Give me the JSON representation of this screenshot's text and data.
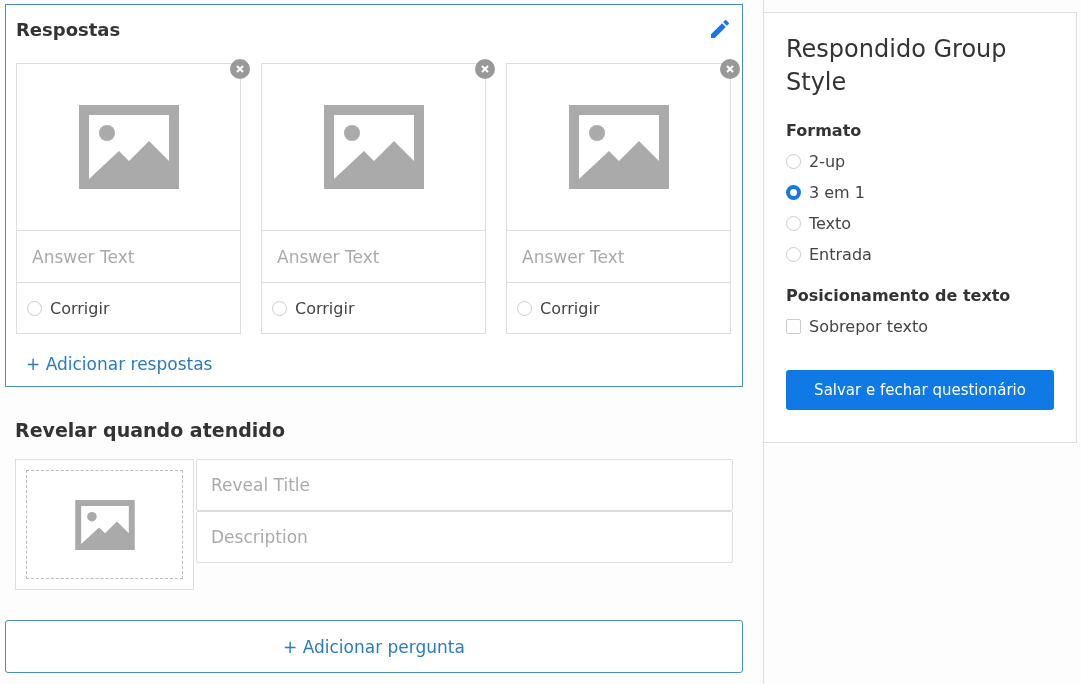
{
  "answers": {
    "title": "Respostas",
    "items": [
      {
        "placeholder": "Answer Text",
        "correct_label": "Corrigir",
        "selected": false
      },
      {
        "placeholder": "Answer Text",
        "correct_label": "Corrigir",
        "selected": false
      },
      {
        "placeholder": "Answer Text",
        "correct_label": "Corrigir",
        "selected": false
      }
    ],
    "add_label": "+ Adicionar respostas"
  },
  "reveal": {
    "title": "Revelar quando atendido",
    "title_placeholder": "Reveal Title",
    "description_placeholder": "Description"
  },
  "add_question": "+ Adicionar pergunta",
  "style_panel": {
    "title": "Respondido Group Style",
    "format_label": "Formato",
    "formats": [
      {
        "label": "2-up",
        "selected": false
      },
      {
        "label": "3 em 1",
        "selected": true
      },
      {
        "label": "Texto",
        "selected": false
      },
      {
        "label": "Entrada",
        "selected": false
      }
    ],
    "text_position_label": "Posicionamento de texto",
    "overlay": {
      "label": "Sobrepor texto",
      "checked": false
    },
    "save_button": "Salvar e fechar questionário"
  }
}
